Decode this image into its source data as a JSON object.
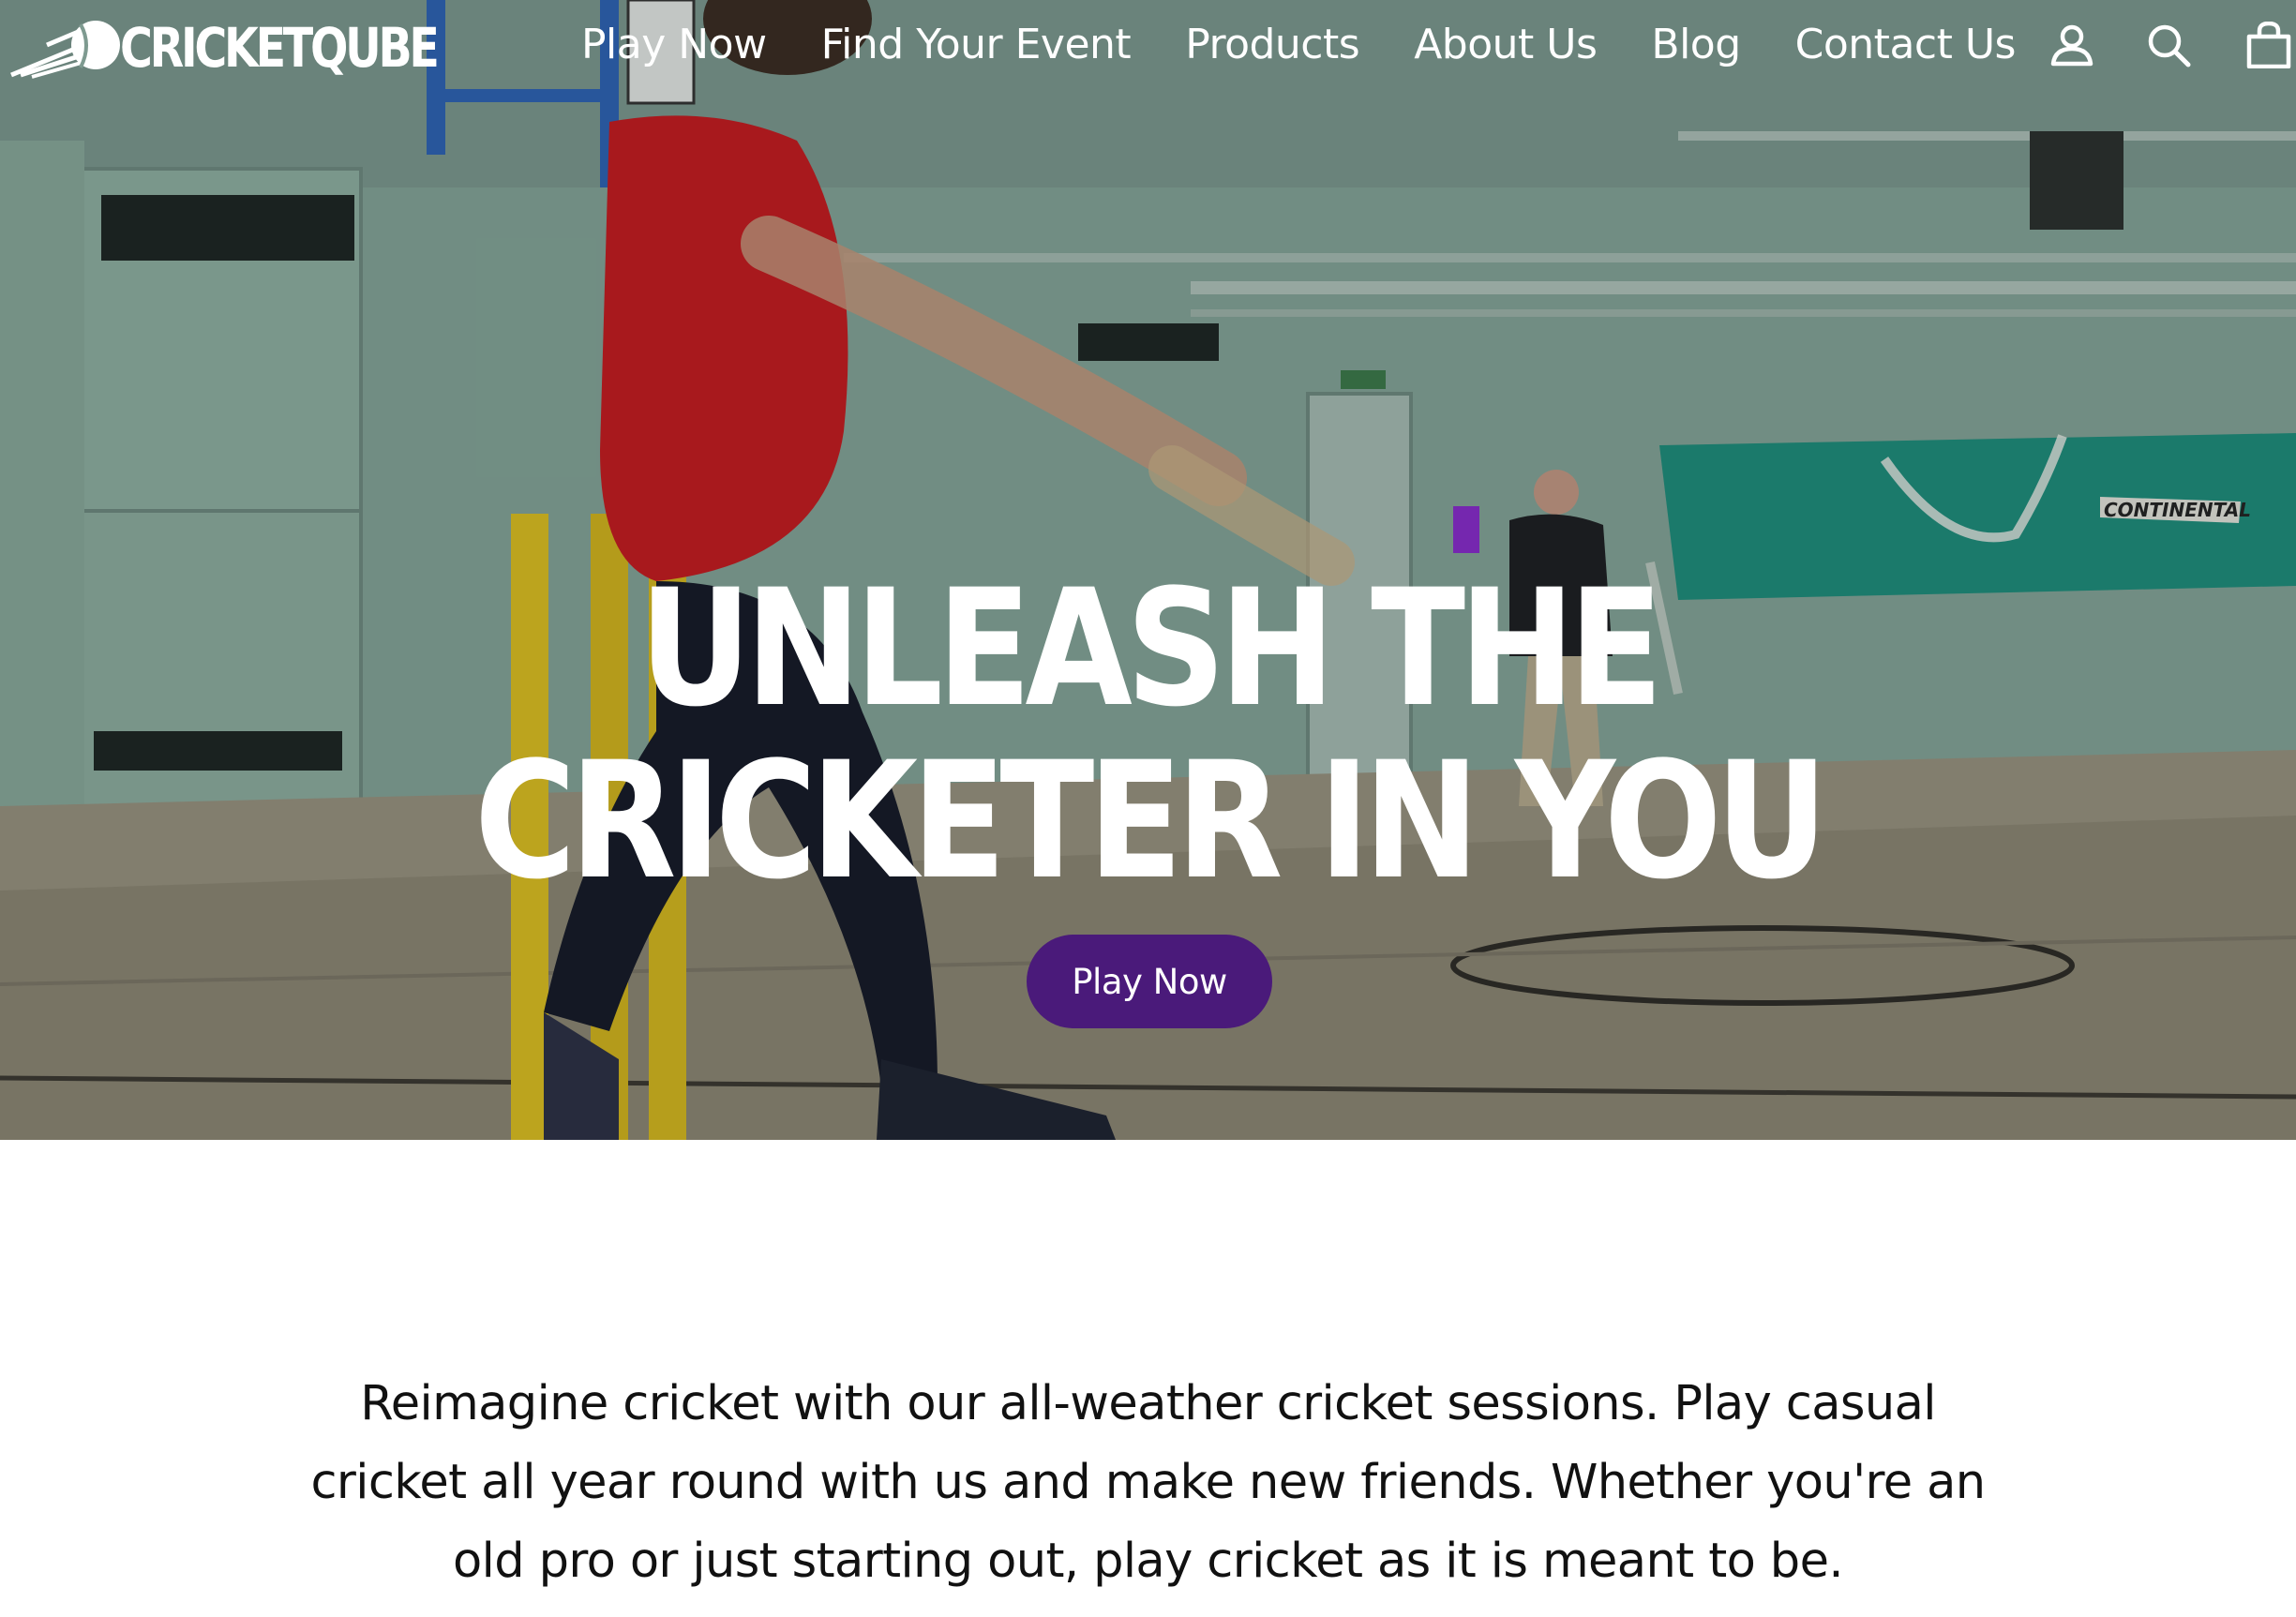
{
  "brand": {
    "name": "CRICKETQUBE"
  },
  "nav": {
    "links": [
      {
        "label": "Play Now"
      },
      {
        "label": "Find Your Event"
      },
      {
        "label": "Products"
      },
      {
        "label": "About Us"
      },
      {
        "label": "Blog"
      },
      {
        "label": "Contact Us"
      }
    ],
    "icons": [
      "account-icon",
      "search-icon",
      "cart-icon"
    ]
  },
  "hero": {
    "title_line1": "UNLEASH THE",
    "title_line2": "CRICKETER IN YOU",
    "cta_label": "Play Now",
    "cta_color": "#4a1a7a",
    "banner_text": "CONTINENTAL"
  },
  "intro": {
    "text": "Reimagine cricket with our all-weather cricket sessions. Play casual cricket all year round with us and make new friends. Whether you're an old pro or just starting out, play cricket as it is meant to be."
  }
}
